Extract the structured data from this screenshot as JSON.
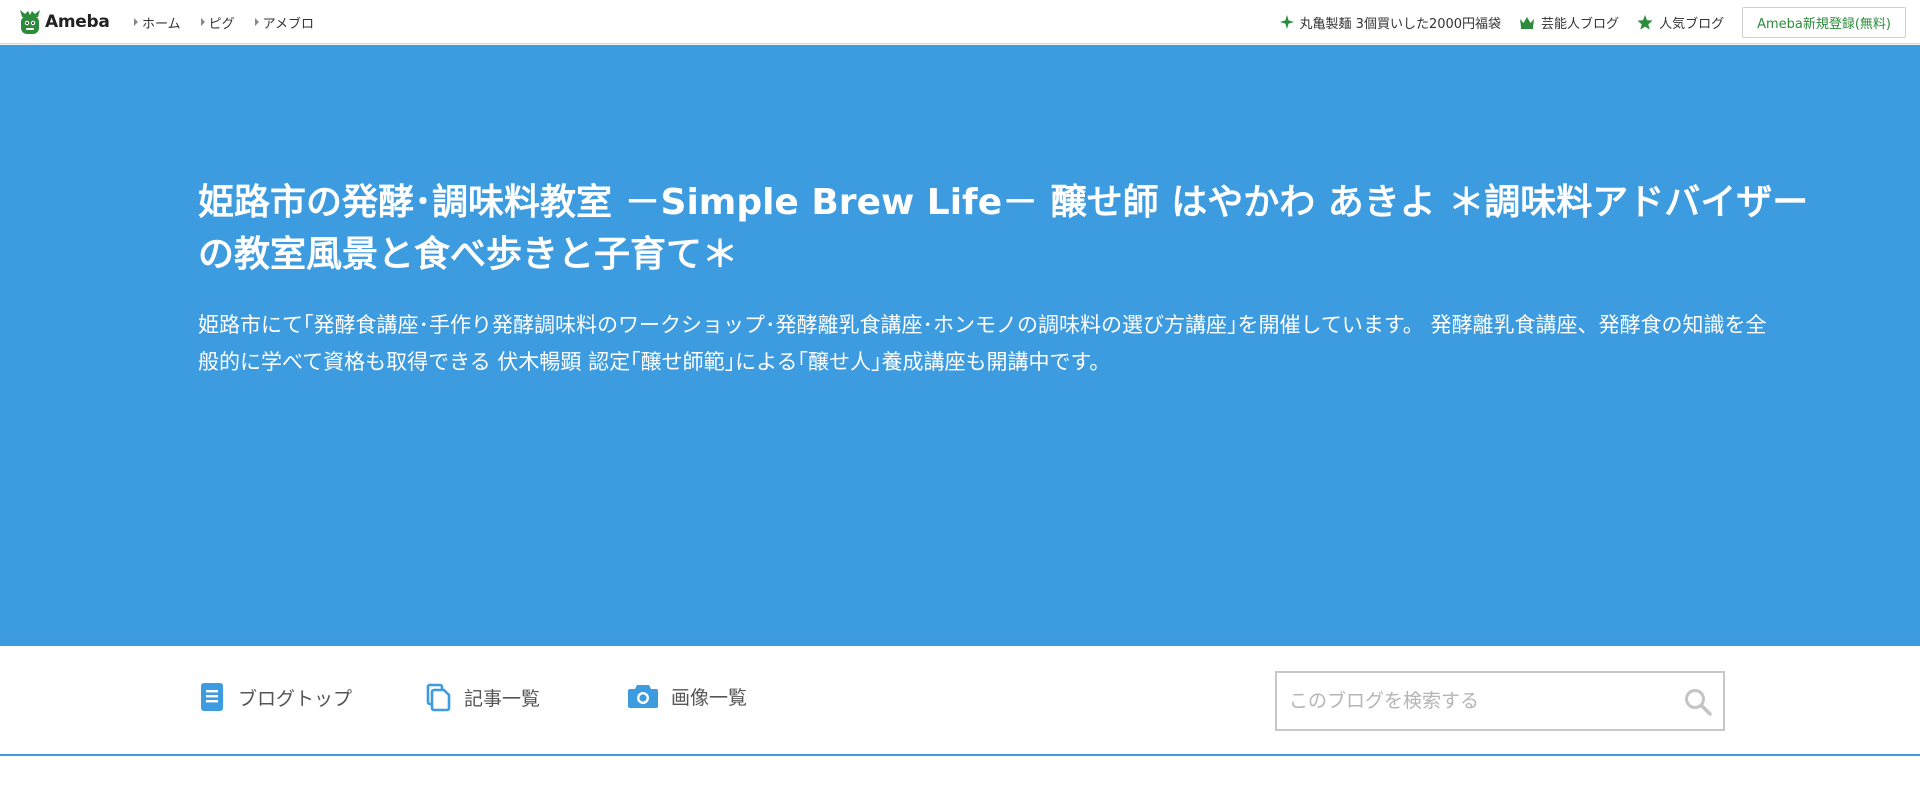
{
  "brand": {
    "name": "Ameba"
  },
  "top_nav": [
    {
      "label": "ホーム"
    },
    {
      "label": "ピグ"
    },
    {
      "label": "アメブロ"
    }
  ],
  "top_right": {
    "promo_label": "丸亀製麺 3個買いした2000円福袋",
    "celebrity_blog_label": "芸能人ブログ",
    "popular_blog_label": "人気ブログ",
    "register_label": "Ameba新規登録(無料)"
  },
  "hero": {
    "title": "姫路市の発酵･調味料教室 －Simple Brew Life－ 醸せ師 はやかわ あきよ ＊調味料アドバイザーの教室風景と食べ歩きと子育て＊",
    "description": "姫路市にて｢発酵食講座･手作り発酵調味料のワークショップ･発酵離乳食講座･ホンモノの調味料の選び方講座｣を開催しています。 発酵離乳食講座、発酵食の知識を全般的に学べて資格も取得できる 伏木暢顕 認定｢醸せ師範｣による｢醸せ人｣養成講座も開講中です。"
  },
  "sub_nav": [
    {
      "label": "ブログトップ",
      "icon": "document-icon"
    },
    {
      "label": "記事一覧",
      "icon": "copy-icon"
    },
    {
      "label": "画像一覧",
      "icon": "camera-icon"
    }
  ],
  "search": {
    "placeholder": "このブログを検索する",
    "value": ""
  },
  "colors": {
    "hero_bg": "#3d9be0",
    "accent_green": "#2d8c3c",
    "icon_blue": "#3d9be0"
  }
}
